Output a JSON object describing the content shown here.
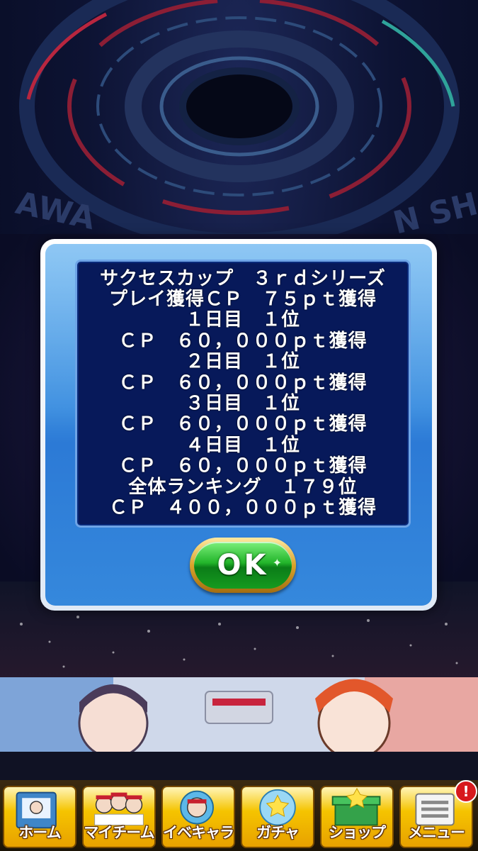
{
  "background": {
    "banner_left_text": "AWA",
    "banner_right_text": "N SH"
  },
  "dialog": {
    "lines": [
      "サクセスカップ　３ｒｄシリーズ",
      "プレイ獲得ＣＰ　７５ｐｔ獲得",
      "１日目　１位",
      "ＣＰ　６０，０００ｐｔ獲得",
      "２日目　１位",
      "ＣＰ　６０，０００ｐｔ獲得",
      "３日目　１位",
      "ＣＰ　６０，０００ｐｔ獲得",
      "４日目　１位",
      "ＣＰ　６０，０００ｐｔ獲得",
      "全体ランキング　１７９位",
      "ＣＰ　４００，０００ｐｔ獲得"
    ],
    "ok_label": "OK"
  },
  "nav": {
    "items": [
      {
        "label": "ホーム",
        "icon": "home-notebook-icon"
      },
      {
        "label": "マイチーム",
        "icon": "team-players-icon"
      },
      {
        "label": "イベキャラ",
        "icon": "event-character-icon"
      },
      {
        "label": "ガチャ",
        "icon": "gacha-capsule-icon"
      },
      {
        "label": "ショップ",
        "icon": "shop-box-icon"
      },
      {
        "label": "メニュー",
        "icon": "menu-list-icon"
      }
    ],
    "badge": "!"
  },
  "colors": {
    "dialog_blue": "#3d8fe0",
    "message_bg": "#07195a",
    "ok_green": "#22b52a",
    "nav_gold": "#f5c400",
    "badge_red": "#d7191c"
  }
}
